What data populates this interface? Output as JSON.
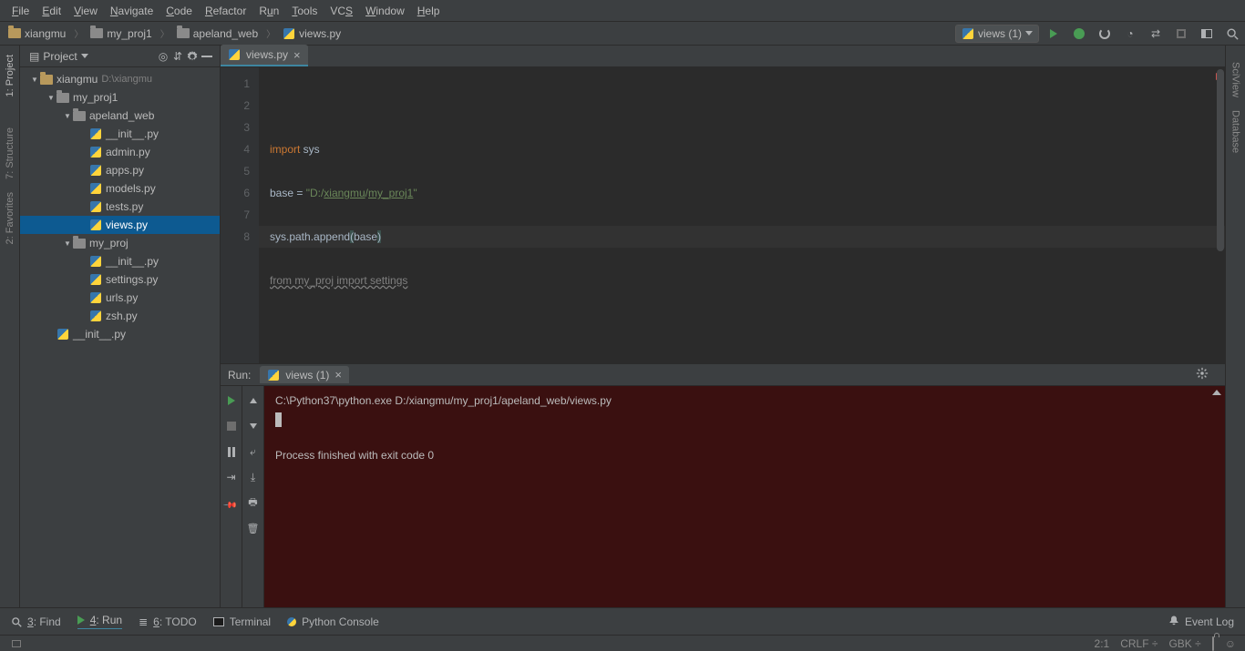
{
  "menu": [
    "File",
    "Edit",
    "View",
    "Navigate",
    "Code",
    "Refactor",
    "Run",
    "Tools",
    "VCS",
    "Window",
    "Help"
  ],
  "menu_mnemonic_idx": [
    0,
    0,
    0,
    0,
    0,
    0,
    1,
    0,
    2,
    0,
    0
  ],
  "breadcrumbs": [
    {
      "type": "folder-gold",
      "label": "xiangmu"
    },
    {
      "type": "folder",
      "label": "my_proj1"
    },
    {
      "type": "folder",
      "label": "apeland_web"
    },
    {
      "type": "py",
      "label": "views.py"
    }
  ],
  "run_config": {
    "label": "views (1)"
  },
  "tabs": [
    {
      "icon": "py",
      "label": "views.py"
    }
  ],
  "project_panel": {
    "title": "Project"
  },
  "tree": [
    {
      "depth": 0,
      "tw": "open",
      "icon": "folder-gold",
      "label": "xiangmu",
      "hint": "D:\\xiangmu",
      "name": "project-root"
    },
    {
      "depth": 1,
      "tw": "open",
      "icon": "folder",
      "label": "my_proj1",
      "name": "folder-myproj1"
    },
    {
      "depth": 2,
      "tw": "open",
      "icon": "folder",
      "label": "apeland_web",
      "name": "folder-apeland-web"
    },
    {
      "depth": 3,
      "tw": "",
      "icon": "py",
      "label": "__init__.py",
      "name": "file-init"
    },
    {
      "depth": 3,
      "tw": "",
      "icon": "py",
      "label": "admin.py",
      "name": "file-admin"
    },
    {
      "depth": 3,
      "tw": "",
      "icon": "py",
      "label": "apps.py",
      "name": "file-apps"
    },
    {
      "depth": 3,
      "tw": "",
      "icon": "py",
      "label": "models.py",
      "name": "file-models"
    },
    {
      "depth": 3,
      "tw": "",
      "icon": "py",
      "label": "tests.py",
      "name": "file-tests"
    },
    {
      "depth": 3,
      "tw": "",
      "icon": "py",
      "label": "views.py",
      "name": "file-views",
      "selected": true
    },
    {
      "depth": 2,
      "tw": "open",
      "icon": "folder",
      "label": "my_proj",
      "name": "folder-myproj"
    },
    {
      "depth": 3,
      "tw": "",
      "icon": "py",
      "label": "__init__.py",
      "name": "file-init2"
    },
    {
      "depth": 3,
      "tw": "",
      "icon": "py",
      "label": "settings.py",
      "name": "file-settings"
    },
    {
      "depth": 3,
      "tw": "",
      "icon": "py",
      "label": "urls.py",
      "name": "file-urls"
    },
    {
      "depth": 3,
      "tw": "",
      "icon": "py",
      "label": "zsh.py",
      "name": "file-zsh"
    },
    {
      "depth": 1,
      "tw": "",
      "icon": "py",
      "label": "__init__.py",
      "name": "file-init3"
    }
  ],
  "code": {
    "lines": [
      {
        "n": 1,
        "html": "<span class='kw'>import</span> sys"
      },
      {
        "n": 2,
        "html": ""
      },
      {
        "n": 3,
        "html": "base = <span class='str'>\"D:/<span class='und'>xiangmu</span>/<span class='und'>my_proj1</span>\"</span>"
      },
      {
        "n": 4,
        "html": ""
      },
      {
        "n": 5,
        "html": "sys.path.append<span class='paren-hl'>(</span>base<span class='paren-hl'>)</span>",
        "hl": true
      },
      {
        "n": 6,
        "html": ""
      },
      {
        "n": 7,
        "html": "<span class='import-gray'>from my_proj import settings</span>"
      },
      {
        "n": 8,
        "html": ""
      }
    ]
  },
  "run_panel": {
    "title": "Run:",
    "tab": "views (1)",
    "lines": [
      "C:\\Python37\\python.exe D:/xiangmu/my_proj1/apeland_web/views.py",
      "",
      "",
      "Process finished with exit code 0"
    ]
  },
  "lower": [
    {
      "icon": "search",
      "label": "3: Find",
      "u": 0,
      "name": "tool-find"
    },
    {
      "icon": "run",
      "label": "4: Run",
      "u": 0,
      "active": true,
      "name": "tool-run"
    },
    {
      "icon": "list",
      "label": "6: TODO",
      "u": 0,
      "name": "tool-todo"
    },
    {
      "icon": "term",
      "label": "Terminal",
      "name": "tool-terminal"
    },
    {
      "icon": "pyc",
      "label": "Python Console",
      "name": "tool-python-console"
    }
  ],
  "event_log": "Event Log",
  "status": {
    "pos": "2:1",
    "eol": "CRLF",
    "enc": "GBK"
  },
  "side_left": [
    {
      "label": "1: Project",
      "active": true,
      "name": "toolwin-project"
    },
    {
      "label": "7: Structure",
      "name": "toolwin-structure"
    },
    {
      "label": "2: Favorites",
      "name": "toolwin-favorites"
    }
  ],
  "side_left_icons": [
    "📁",
    "📊",
    "★"
  ],
  "side_right": [
    {
      "label": "SciView",
      "name": "toolwin-sciview"
    },
    {
      "label": "Database",
      "name": "toolwin-database"
    }
  ]
}
